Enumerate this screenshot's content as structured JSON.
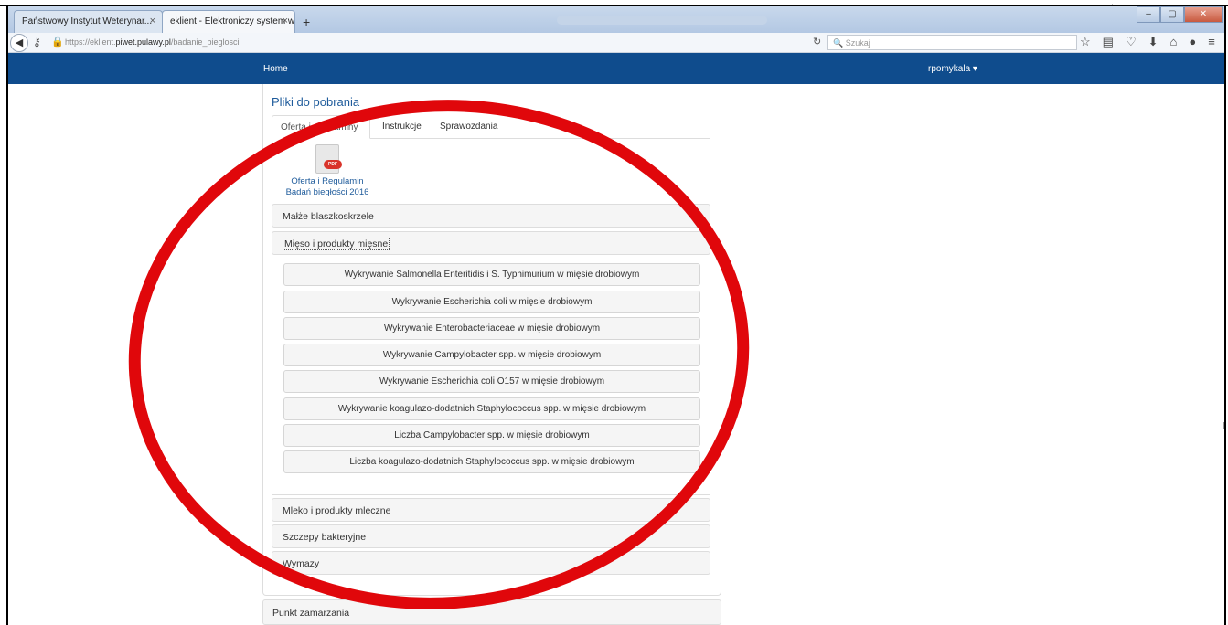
{
  "browser": {
    "tabs": [
      {
        "label": "Państwowy Instytut Weterynar..."
      },
      {
        "label": "eklient - Elektroniczy system w..."
      }
    ],
    "new_tab": "+",
    "close_glyph": "×",
    "url_prefix": "https://eklient.",
    "url_domain": "piwet.pulawy.pl",
    "url_path": "/badanie_bieglosci",
    "search_placeholder": "Szukaj",
    "corner_glyph": "ţ"
  },
  "site_nav": {
    "home": "Home",
    "user": "rpomykala ▾"
  },
  "downloads": {
    "title": "Pliki do pobrania",
    "tabs": [
      "Oferta i regulaminy",
      "Instrukcje",
      "Sprawozdania"
    ],
    "pdf_badge": "PDF",
    "file_caption_1": "Oferta i Regulamin",
    "file_caption_2": "Badań biegłości 2016"
  },
  "accordion": {
    "sections": [
      "Małże blaszkoskrzele",
      "Mięso i produkty mięsne",
      "Mleko i produkty mleczne",
      "Szczepy bakteryjne",
      "Wymazy"
    ],
    "meat_items": [
      "Wykrywanie Salmonella Enteritidis i S. Typhimurium w mięsie drobiowym",
      "Wykrywanie Escherichia coli w mięsie drobiowym",
      "Wykrywanie Enterobacteriaceae w mięsie drobiowym",
      "Wykrywanie Campylobacter spp. w mięsie drobiowym",
      "Wykrywanie Escherichia coli O157 w mięsie drobiowym",
      "Wykrywanie koagulazo-dodatnich Staphylococcus spp. w mięsie drobiowym",
      "Liczba Campylobacter spp. w mięsie drobiowym",
      "Liczba koagulazo-dodatnich Staphylococcus spp. w mięsie drobiowym"
    ]
  },
  "bottom_section": "Punkt zamarzania",
  "colors": {
    "site_nav": "#0f4c8d",
    "link": "#1e5b9b",
    "annotation": "#e0070b"
  }
}
